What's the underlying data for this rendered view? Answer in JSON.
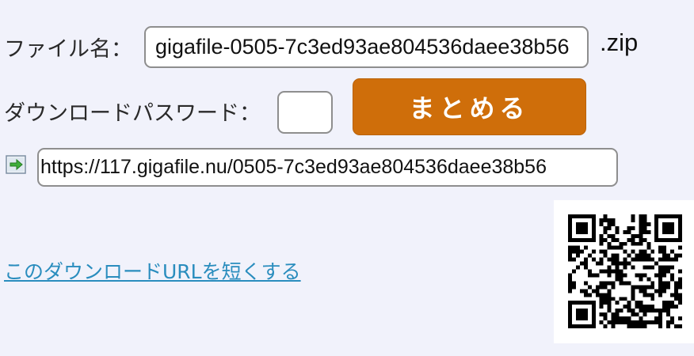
{
  "form": {
    "filename_label": "ファイル名：",
    "filename_value": "gigafile-0505-7c3ed93ae804536daee38b56",
    "extension": ".zip",
    "password_label": "ダウンロードパスワード：",
    "password_value": "",
    "matomeru_button": "まとめる"
  },
  "download": {
    "icon": "document-arrow-icon",
    "url": "https://117.gigafile.nu/0505-7c3ed93ae804536daee38b56",
    "shorten_link": "このダウンロードURLを短くする"
  },
  "qr": {
    "icon": "qr-code"
  },
  "colors": {
    "background": "#f1f2fb",
    "button": "#cf6e0a",
    "link": "#2a8dbe"
  }
}
